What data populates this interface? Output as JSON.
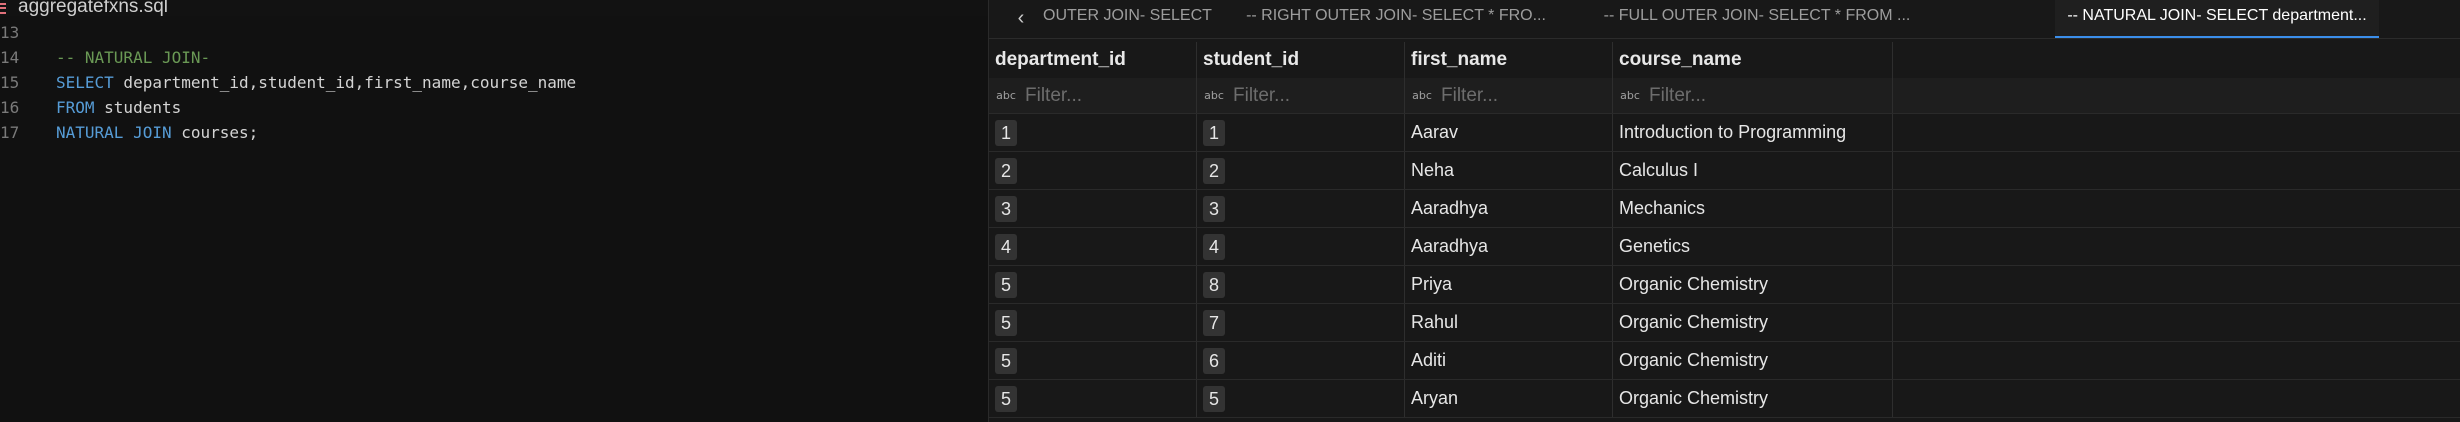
{
  "editor": {
    "file_name": "aggregatefxns.sql",
    "lines": [
      {
        "num": "13",
        "tokens": []
      },
      {
        "num": "14",
        "tokens": [
          {
            "t": "comment",
            "text": "-- NATURAL JOIN-"
          }
        ]
      },
      {
        "num": "15",
        "tokens": [
          {
            "t": "kw",
            "text": "SELECT"
          },
          {
            "t": "id",
            "text": " department_id,student_id,first_name,course_name"
          }
        ]
      },
      {
        "num": "16",
        "tokens": [
          {
            "t": "kw",
            "text": "FROM"
          },
          {
            "t": "id",
            "text": " students"
          }
        ]
      },
      {
        "num": "17",
        "tokens": [
          {
            "t": "kw",
            "text": "NATURAL JOIN"
          },
          {
            "t": "id",
            "text": " courses;"
          }
        ]
      }
    ]
  },
  "results": {
    "tabs": [
      {
        "label": "OUTER JOIN- SELECT Students...",
        "active": false
      },
      {
        "label": "-- RIGHT OUTER JOIN- SELECT * FRO...",
        "active": false
      },
      {
        "label": "-- FULL OUTER JOIN- SELECT * FROM ...",
        "active": false
      },
      {
        "label": "-- NATURAL JOIN- SELECT department...",
        "active": true
      }
    ],
    "columns": [
      "department_id",
      "student_id",
      "first_name",
      "course_name"
    ],
    "filter_placeholder": "Filter...",
    "filter_icon": "abc",
    "rows": [
      {
        "department_id": "1",
        "student_id": "1",
        "first_name": "Aarav",
        "course_name": "Introduction to Programming"
      },
      {
        "department_id": "2",
        "student_id": "2",
        "first_name": "Neha",
        "course_name": "Calculus I"
      },
      {
        "department_id": "3",
        "student_id": "3",
        "first_name": "Aaradhya",
        "course_name": "Mechanics"
      },
      {
        "department_id": "4",
        "student_id": "4",
        "first_name": "Aaradhya",
        "course_name": "Genetics"
      },
      {
        "department_id": "5",
        "student_id": "8",
        "first_name": "Priya",
        "course_name": "Organic Chemistry"
      },
      {
        "department_id": "5",
        "student_id": "7",
        "first_name": "Rahul",
        "course_name": "Organic Chemistry"
      },
      {
        "department_id": "5",
        "student_id": "6",
        "first_name": "Aditi",
        "course_name": "Organic Chemistry"
      },
      {
        "department_id": "5",
        "student_id": "5",
        "first_name": "Aryan",
        "course_name": "Organic Chemistry"
      }
    ]
  }
}
